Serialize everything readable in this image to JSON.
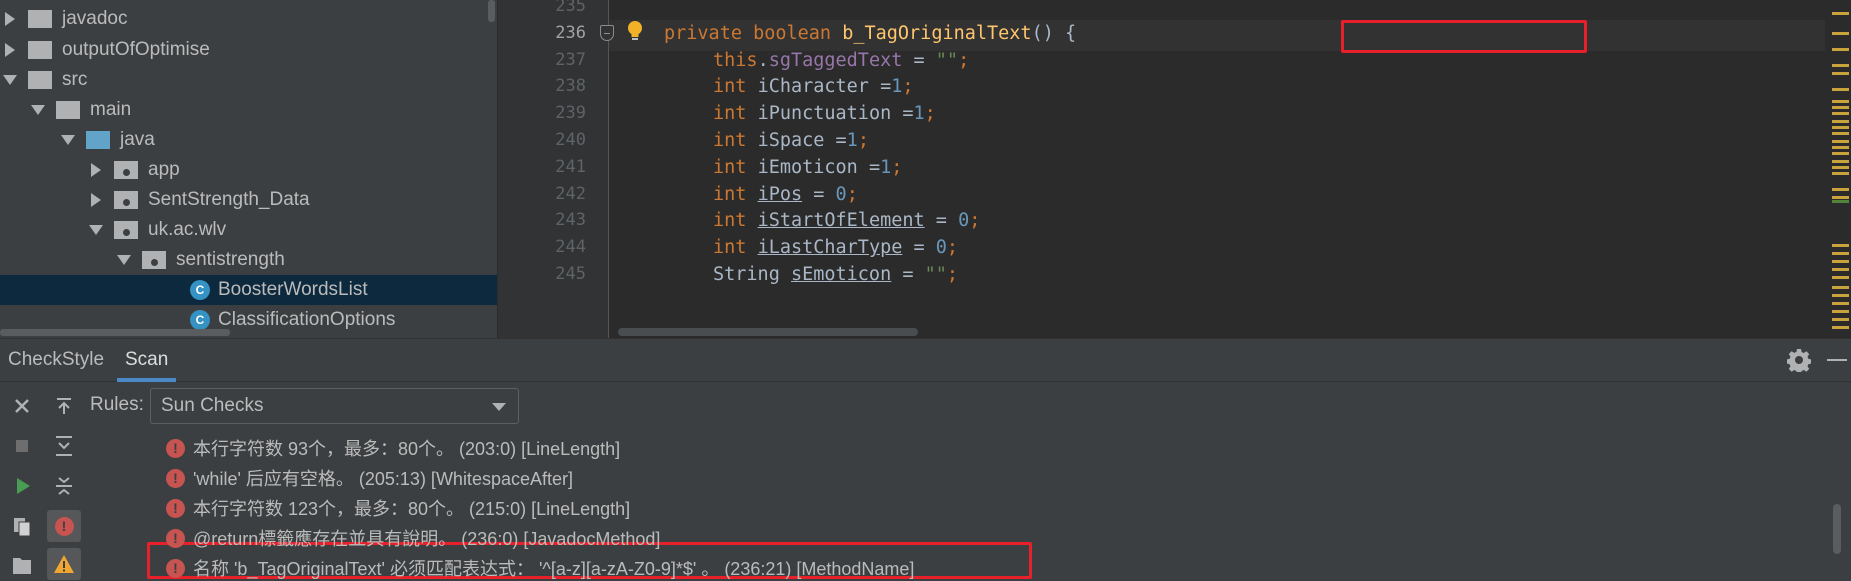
{
  "project_tree": {
    "items": [
      {
        "label": "javadoc",
        "expanded": false,
        "kind": "folder"
      },
      {
        "label": "outputOfOptimise",
        "expanded": false,
        "kind": "folder"
      },
      {
        "label": "src",
        "expanded": true,
        "kind": "folder"
      },
      {
        "label": "main",
        "expanded": true,
        "kind": "folder"
      },
      {
        "label": "java",
        "expanded": true,
        "kind": "source-folder"
      },
      {
        "label": "app",
        "expanded": false,
        "kind": "package"
      },
      {
        "label": "SentStrength_Data",
        "expanded": false,
        "kind": "package"
      },
      {
        "label": "uk.ac.wlv",
        "expanded": true,
        "kind": "package"
      },
      {
        "label": "sentistrength",
        "expanded": true,
        "kind": "package"
      },
      {
        "label": "BoosterWordsList",
        "kind": "class",
        "selected": true
      },
      {
        "label": "ClassificationOptions",
        "kind": "class"
      }
    ]
  },
  "editor": {
    "current_line": "236",
    "lines": [
      {
        "num": "235",
        "tokens": []
      },
      {
        "num": "236",
        "tokens": [
          {
            "t": "private ",
            "c": "kw"
          },
          {
            "t": "boolean ",
            "c": "kw"
          },
          {
            "t": "b_TagOriginalText",
            "c": "fn"
          },
          {
            "t": "() {",
            "c": "plain"
          }
        ]
      },
      {
        "num": "237",
        "tokens": [
          {
            "t": "this",
            "c": "kw"
          },
          {
            "t": ".",
            "c": "plain"
          },
          {
            "t": "sgTaggedText",
            "c": "fld"
          },
          {
            "t": " = ",
            "c": "plain"
          },
          {
            "t": "\"\"",
            "c": "str"
          },
          {
            "t": ";",
            "c": "kw"
          }
        ]
      },
      {
        "num": "238",
        "tokens": [
          {
            "t": "int ",
            "c": "kw"
          },
          {
            "t": "iCharacter =",
            "c": "plain"
          },
          {
            "t": "1",
            "c": "num"
          },
          {
            "t": ";",
            "c": "kw"
          }
        ]
      },
      {
        "num": "239",
        "tokens": [
          {
            "t": "int ",
            "c": "kw"
          },
          {
            "t": "iPunctuation =",
            "c": "plain"
          },
          {
            "t": "1",
            "c": "num"
          },
          {
            "t": ";",
            "c": "kw"
          }
        ]
      },
      {
        "num": "240",
        "tokens": [
          {
            "t": "int ",
            "c": "kw"
          },
          {
            "t": "iSpace =",
            "c": "plain"
          },
          {
            "t": "1",
            "c": "num"
          },
          {
            "t": ";",
            "c": "kw"
          }
        ]
      },
      {
        "num": "241",
        "tokens": [
          {
            "t": "int ",
            "c": "kw"
          },
          {
            "t": "iEmoticon =",
            "c": "plain"
          },
          {
            "t": "1",
            "c": "num"
          },
          {
            "t": ";",
            "c": "kw"
          }
        ]
      },
      {
        "num": "242",
        "tokens": [
          {
            "t": "int ",
            "c": "kw"
          },
          {
            "t": "iPos",
            "c": "ul"
          },
          {
            "t": " = ",
            "c": "plain"
          },
          {
            "t": "0",
            "c": "num"
          },
          {
            "t": ";",
            "c": "kw"
          }
        ]
      },
      {
        "num": "243",
        "tokens": [
          {
            "t": "int ",
            "c": "kw"
          },
          {
            "t": "iStartOfElement",
            "c": "ul"
          },
          {
            "t": " = ",
            "c": "plain"
          },
          {
            "t": "0",
            "c": "num"
          },
          {
            "t": ";",
            "c": "kw"
          }
        ]
      },
      {
        "num": "244",
        "tokens": [
          {
            "t": "int ",
            "c": "kw"
          },
          {
            "t": "iLastCharType",
            "c": "ul"
          },
          {
            "t": " = ",
            "c": "plain"
          },
          {
            "t": "0",
            "c": "num"
          },
          {
            "t": ";",
            "c": "kw"
          }
        ]
      },
      {
        "num": "245",
        "tokens": [
          {
            "t": "String ",
            "c": "plain"
          },
          {
            "t": "sEmoticon",
            "c": "ul"
          },
          {
            "t": " = ",
            "c": "plain"
          },
          {
            "t": "\"\"",
            "c": "str"
          },
          {
            "t": ";",
            "c": "kw"
          }
        ]
      }
    ]
  },
  "tool_window": {
    "tabs": [
      {
        "label": "CheckStyle",
        "active": false
      },
      {
        "label": "Scan",
        "active": true
      }
    ],
    "rules_label": "Rules:",
    "rules_value": "Sun Checks",
    "results": [
      {
        "text": "本行字符数 93个，最多：80个。 (203:0) [LineLength]"
      },
      {
        "text": "'while' 后应有空格。 (205:13) [WhitespaceAfter]"
      },
      {
        "text": "本行字符数 123个，最多：80个。 (215:0) [LineLength]"
      },
      {
        "text": "@return標籤應存在並具有說明。 (236:0) [JavadocMethod]"
      },
      {
        "text": "名称 'b_TagOriginalText' 必须匹配表达式： '^[a-z][a-zA-Z0-9]*$' 。 (236:21) [MethodName]",
        "highlighted": true
      }
    ]
  },
  "colors": {
    "highlight_box": "#e8202a",
    "error_icon": "#c75450",
    "accent_tab": "#4a88c7",
    "selection": "#0d293e"
  }
}
